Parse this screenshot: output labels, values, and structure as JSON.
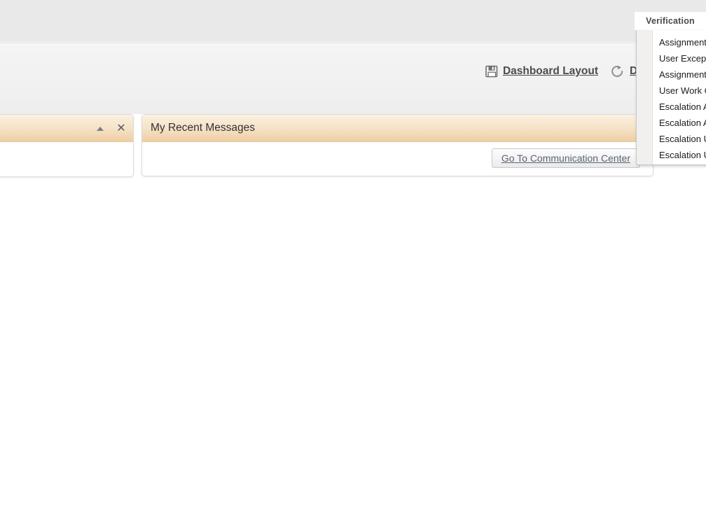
{
  "menubar": {
    "tab": {
      "label": "Verification"
    }
  },
  "toolbar": {
    "actions": [
      {
        "label": "Dashboard Layout",
        "icon": "save-icon"
      },
      {
        "label": "Def",
        "icon": "refresh-icon"
      }
    ]
  },
  "panels": [
    {
      "name": "left-panel",
      "title": "",
      "collapse_icon": "collapse-triangle-icon",
      "close_icon": "close-icon",
      "has_close": true
    },
    {
      "name": "my-recent-messages-panel",
      "title": "My Recent Messages",
      "collapse_icon": "collapse-triangle-icon",
      "has_close": false,
      "button": {
        "label": "Go To Communication Center"
      }
    }
  ],
  "dropdown": {
    "items": [
      {
        "label": "Assignment"
      },
      {
        "label": "User Exception"
      },
      {
        "label": "Assignment"
      },
      {
        "label": "User Work Q"
      },
      {
        "label": "Escalation As"
      },
      {
        "label": "Escalation As"
      },
      {
        "label": "Escalation Us"
      },
      {
        "label": "Escalation Us"
      }
    ]
  }
}
